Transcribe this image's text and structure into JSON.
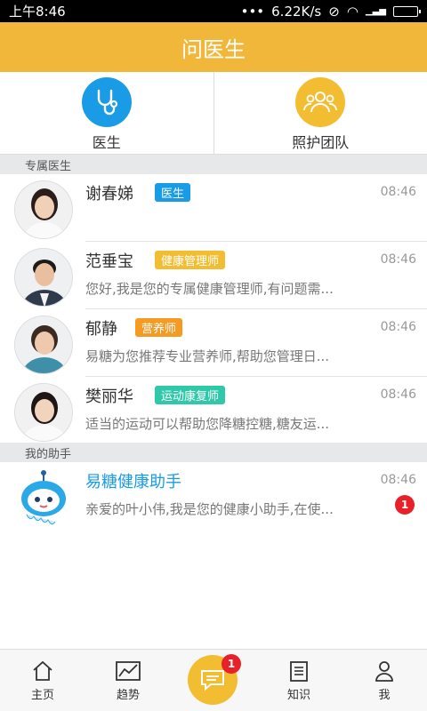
{
  "status": {
    "time": "上午8:46",
    "speed": "6.22K/s"
  },
  "header": {
    "title": "问医生"
  },
  "quick": [
    {
      "label": "医生",
      "icon": "stethoscope-icon",
      "color": "#1a9be6"
    },
    {
      "label": "照护团队",
      "icon": "team-icon",
      "color": "#f3bd32"
    }
  ],
  "sections": {
    "doctors": "专属医生",
    "assistant": "我的助手"
  },
  "doctors": [
    {
      "name": "谢春娣",
      "tag": "医生",
      "tag_color": "#1a9be6",
      "time": "08:46",
      "message": ""
    },
    {
      "name": "范垂宝",
      "tag": "健康管理师",
      "tag_color": "#f3bd32",
      "time": "08:46",
      "message": "您好,我是您的专属健康管理师,有问题需..."
    },
    {
      "name": "郁静",
      "tag": "营养师",
      "tag_color": "#f59a23",
      "time": "08:46",
      "message": "易糖为您推荐专业营养师,帮助您管理日..."
    },
    {
      "name": "樊丽华",
      "tag": "运动康复师",
      "tag_color": "#2fc8a8",
      "time": "08:46",
      "message": "适当的运动可以帮助您降糖控糖,糖友运..."
    }
  ],
  "assistant": {
    "name": "易糖健康助手",
    "time": "08:46",
    "message": "亲爱的叶小伟,我是您的健康小助手,在使...",
    "badge": "1"
  },
  "tabs": [
    {
      "label": "主页",
      "icon": "home-icon"
    },
    {
      "label": "趋势",
      "icon": "trend-icon"
    },
    {
      "label": "",
      "icon": "chat-icon",
      "badge": "1"
    },
    {
      "label": "知识",
      "icon": "knowledge-icon"
    },
    {
      "label": "我",
      "icon": "profile-icon"
    }
  ]
}
